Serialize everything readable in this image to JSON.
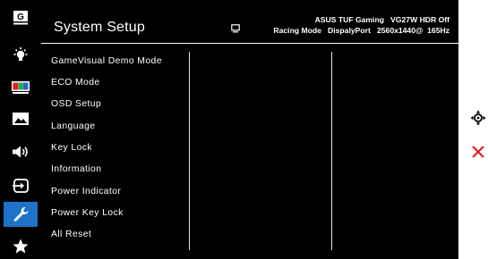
{
  "rail": {
    "items": [
      {
        "icon": "gamevisual-g-icon",
        "active": false
      },
      {
        "icon": "bluelight-filter-icon",
        "active": false
      },
      {
        "icon": "color-bars-icon",
        "active": false
      },
      {
        "icon": "image-icon",
        "active": false
      },
      {
        "icon": "sound-icon",
        "active": false
      },
      {
        "icon": "input-select-icon",
        "active": false
      },
      {
        "icon": "wrench-icon",
        "active": true
      },
      {
        "icon": "star-icon",
        "active": false
      }
    ],
    "g_label": "G"
  },
  "header": {
    "title": "System Setup",
    "line1": "ASUS TUF Gaming   VG27W HDR Off",
    "line2": "Racing Mode   DispalyPort   2560x1440@  165Hz"
  },
  "menu": {
    "items": [
      "GameVisual Demo Mode",
      "ECO Mode",
      "OSD Setup",
      "Language",
      "Key Lock",
      "Information",
      "Power Indicator",
      "Power Key Lock",
      "All Reset"
    ]
  },
  "side_controls": [
    {
      "icon": "five-way-navigation-icon"
    },
    {
      "icon": "close-icon"
    }
  ],
  "colors": {
    "background": "#000000",
    "active": "#1e73c8",
    "close": "#e02020",
    "text": "#ffffff"
  }
}
